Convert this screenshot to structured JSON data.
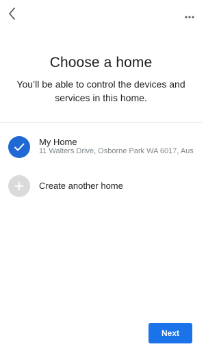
{
  "header": {
    "back_icon": "chevron-left-icon",
    "more_icon": "more-horizontal-icon"
  },
  "main": {
    "title": "Choose a home",
    "subtitle": "You’ll be able to control the devices and services in this home."
  },
  "homes": [
    {
      "name": "My Home",
      "address": "11 Walters Drive, Osborne Park WA 6017, Aus",
      "selected": true,
      "icon": "check-icon"
    }
  ],
  "create_home": {
    "label": "Create another home",
    "icon": "plus-icon"
  },
  "footer": {
    "next_label": "Next"
  },
  "colors": {
    "accent": "#1a73e8",
    "selected_circle": "#2069d5",
    "add_circle": "#dadada",
    "secondary_text": "#80868b",
    "divider": "#dadce0"
  }
}
